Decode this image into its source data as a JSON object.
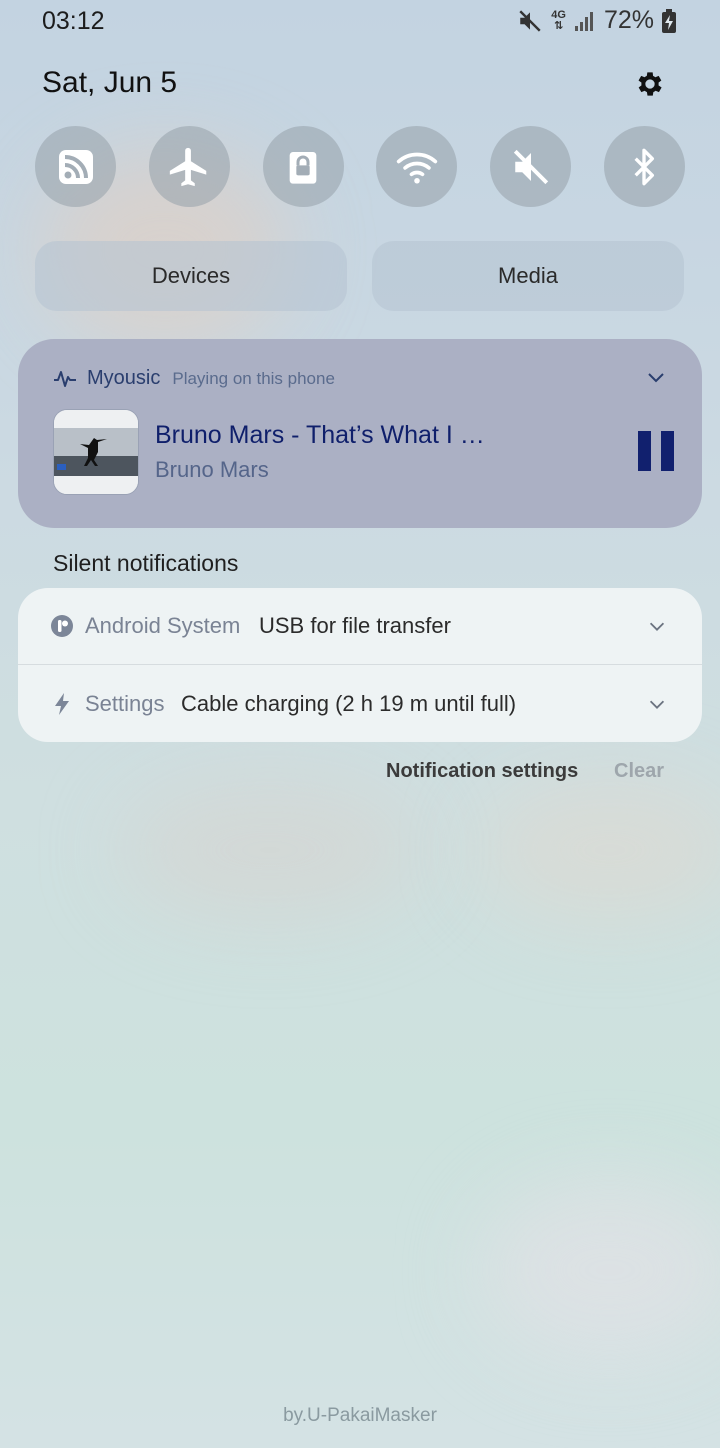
{
  "status_bar": {
    "time": "03:12",
    "network": "4G",
    "battery": "72%"
  },
  "header": {
    "date": "Sat, Jun 5"
  },
  "quick_settings": [
    {
      "name": "rss-icon",
      "label": "RSS"
    },
    {
      "name": "airplane-icon",
      "label": "Airplane mode"
    },
    {
      "name": "lock-icon",
      "label": "Lock"
    },
    {
      "name": "wifi-icon",
      "label": "Wi-Fi"
    },
    {
      "name": "mute-icon",
      "label": "Mute"
    },
    {
      "name": "bluetooth-icon",
      "label": "Bluetooth"
    }
  ],
  "panels": {
    "devices": "Devices",
    "media": "Media"
  },
  "media_player": {
    "app_name": "Myousic",
    "status": "Playing on this phone",
    "title": "Bruno Mars - That’s What I Like (Official Music Video)",
    "artist": "Bruno Mars"
  },
  "silent_notifications": {
    "section_label": "Silent notifications",
    "items": [
      {
        "app": "Android System",
        "text": "USB for file transfer"
      },
      {
        "app": "Settings",
        "text": "Cable charging (2 h 19 m until full)"
      }
    ]
  },
  "actions": {
    "notification_settings": "Notification settings",
    "clear": "Clear"
  },
  "watermark": "by.U-PakaiMasker",
  "colors": {
    "media_card": "#abb0c4",
    "media_title": "#0f1f6b",
    "notif_card": "#eef3f4",
    "qs_button": "#a3adb6"
  }
}
